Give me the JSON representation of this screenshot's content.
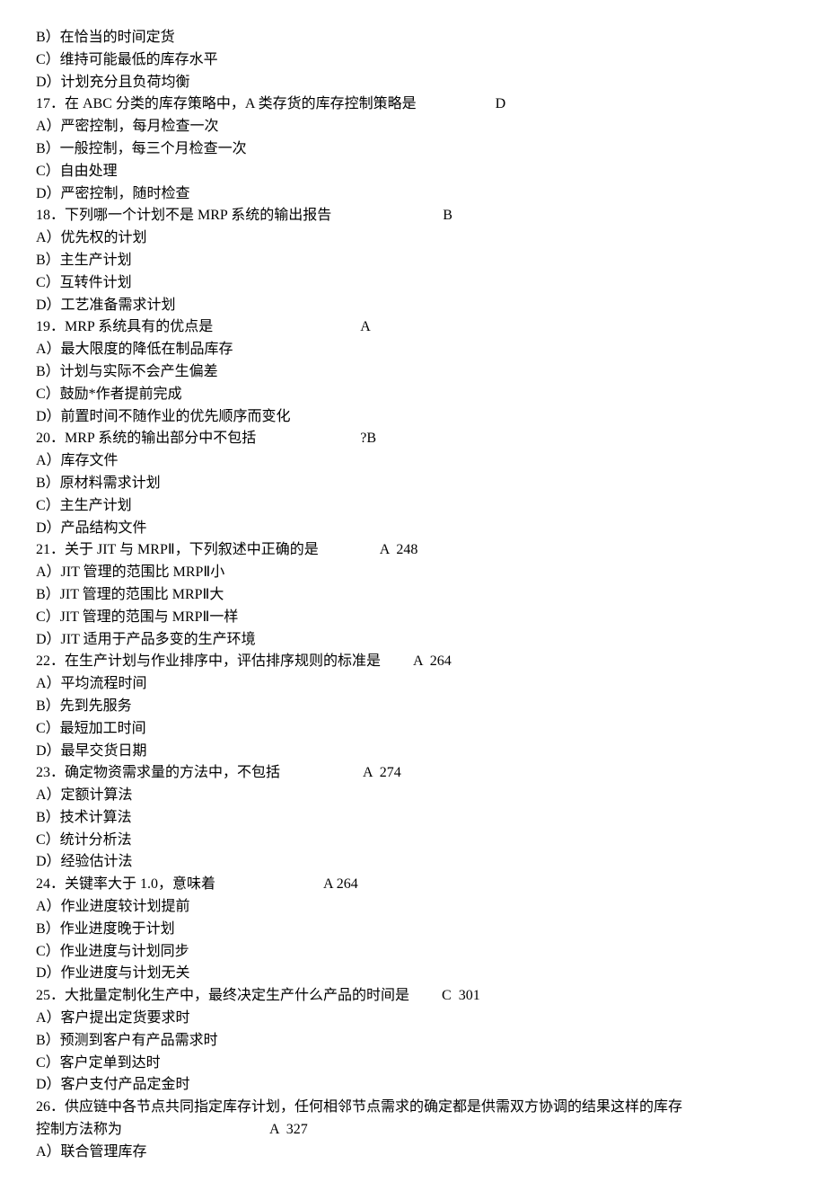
{
  "lines": [
    {
      "text": "B）在恰当的时间定货"
    },
    {
      "text": "C）维持可能最低的库存水平"
    },
    {
      "text": "D）计划充分且负荷均衡"
    },
    {
      "text": "17．在 ABC 分类的库存策略中，A 类存货的库存控制策略是",
      "answer": "D",
      "gap": "                      "
    },
    {
      "text": "A）严密控制，每月检查一次"
    },
    {
      "text": "B）一般控制，每三个月检查一次"
    },
    {
      "text": "C）自由处理"
    },
    {
      "text": "D）严密控制，随时检查"
    },
    {
      "text": "18．下列哪一个计划不是 MRP 系统的输出报告",
      "answer": "B",
      "gap": "                               "
    },
    {
      "text": "A）优先权的计划"
    },
    {
      "text": "B）主生产计划"
    },
    {
      "text": "C）互转件计划"
    },
    {
      "text": "D）工艺准备需求计划"
    },
    {
      "text": "19．MRP 系统具有的优点是",
      "answer": "A",
      "gap": "                                         "
    },
    {
      "text": "A）最大限度的降低在制品库存"
    },
    {
      "text": "B）计划与实际不会产生偏差"
    },
    {
      "text": "C）鼓励*作者提前完成"
    },
    {
      "text": "D）前置时间不随作业的优先顺序而变化"
    },
    {
      "text": "20．MRP 系统的输出部分中不包括",
      "answer": "?B",
      "gap": "                             "
    },
    {
      "text": "A）库存文件"
    },
    {
      "text": "B）原材料需求计划"
    },
    {
      "text": "C）主生产计划"
    },
    {
      "text": "D）产品结构文件"
    },
    {
      "text": "21．关于 JIT 与 MRPⅡ，下列叙述中正确的是",
      "answer": "A  248",
      "gap": "                 "
    },
    {
      "text": "A）JIT 管理的范围比 MRPⅡ小"
    },
    {
      "text": "B）JIT 管理的范围比 MRPⅡ大"
    },
    {
      "text": "C）JIT 管理的范围与 MRPⅡ一样"
    },
    {
      "text": "D）JIT 适用于产品多变的生产环境"
    },
    {
      "text": "22．在生产计划与作业排序中，评估排序规则的标准是",
      "answer": "A  264",
      "gap": "         "
    },
    {
      "text": "A）平均流程时间"
    },
    {
      "text": "B）先到先服务"
    },
    {
      "text": "C）最短加工时间"
    },
    {
      "text": "D）最早交货日期"
    },
    {
      "text": "23．确定物资需求量的方法中，不包括",
      "answer": "A  274",
      "gap": "                       "
    },
    {
      "text": "A）定额计算法"
    },
    {
      "text": "B）技术计算法"
    },
    {
      "text": "C）统计分析法"
    },
    {
      "text": "D）经验估计法"
    },
    {
      "text": "24．关键率大于 1.0，意味着",
      "answer": "A 264",
      "gap": "                              "
    },
    {
      "text": "A）作业进度较计划提前"
    },
    {
      "text": "B）作业进度晚于计划"
    },
    {
      "text": "C）作业进度与计划同步"
    },
    {
      "text": "D）作业进度与计划无关"
    },
    {
      "text": "25．大批量定制化生产中，最终决定生产什么产品的时间是",
      "answer": "C  301",
      "gap": "         "
    },
    {
      "text": "A）客户提出定货要求时"
    },
    {
      "text": "B）预测到客户有产品需求时"
    },
    {
      "text": "C）客户定单到达时"
    },
    {
      "text": "D）客户支付产品定金时"
    },
    {
      "text": "26．供应链中各节点共同指定库存计划，任何相邻节点需求的确定都是供需双方协调的结果这样的库存"
    },
    {
      "text": "控制方法称为",
      "answer": "A  327",
      "gap": "                                         "
    },
    {
      "text": "A）联合管理库存"
    }
  ]
}
